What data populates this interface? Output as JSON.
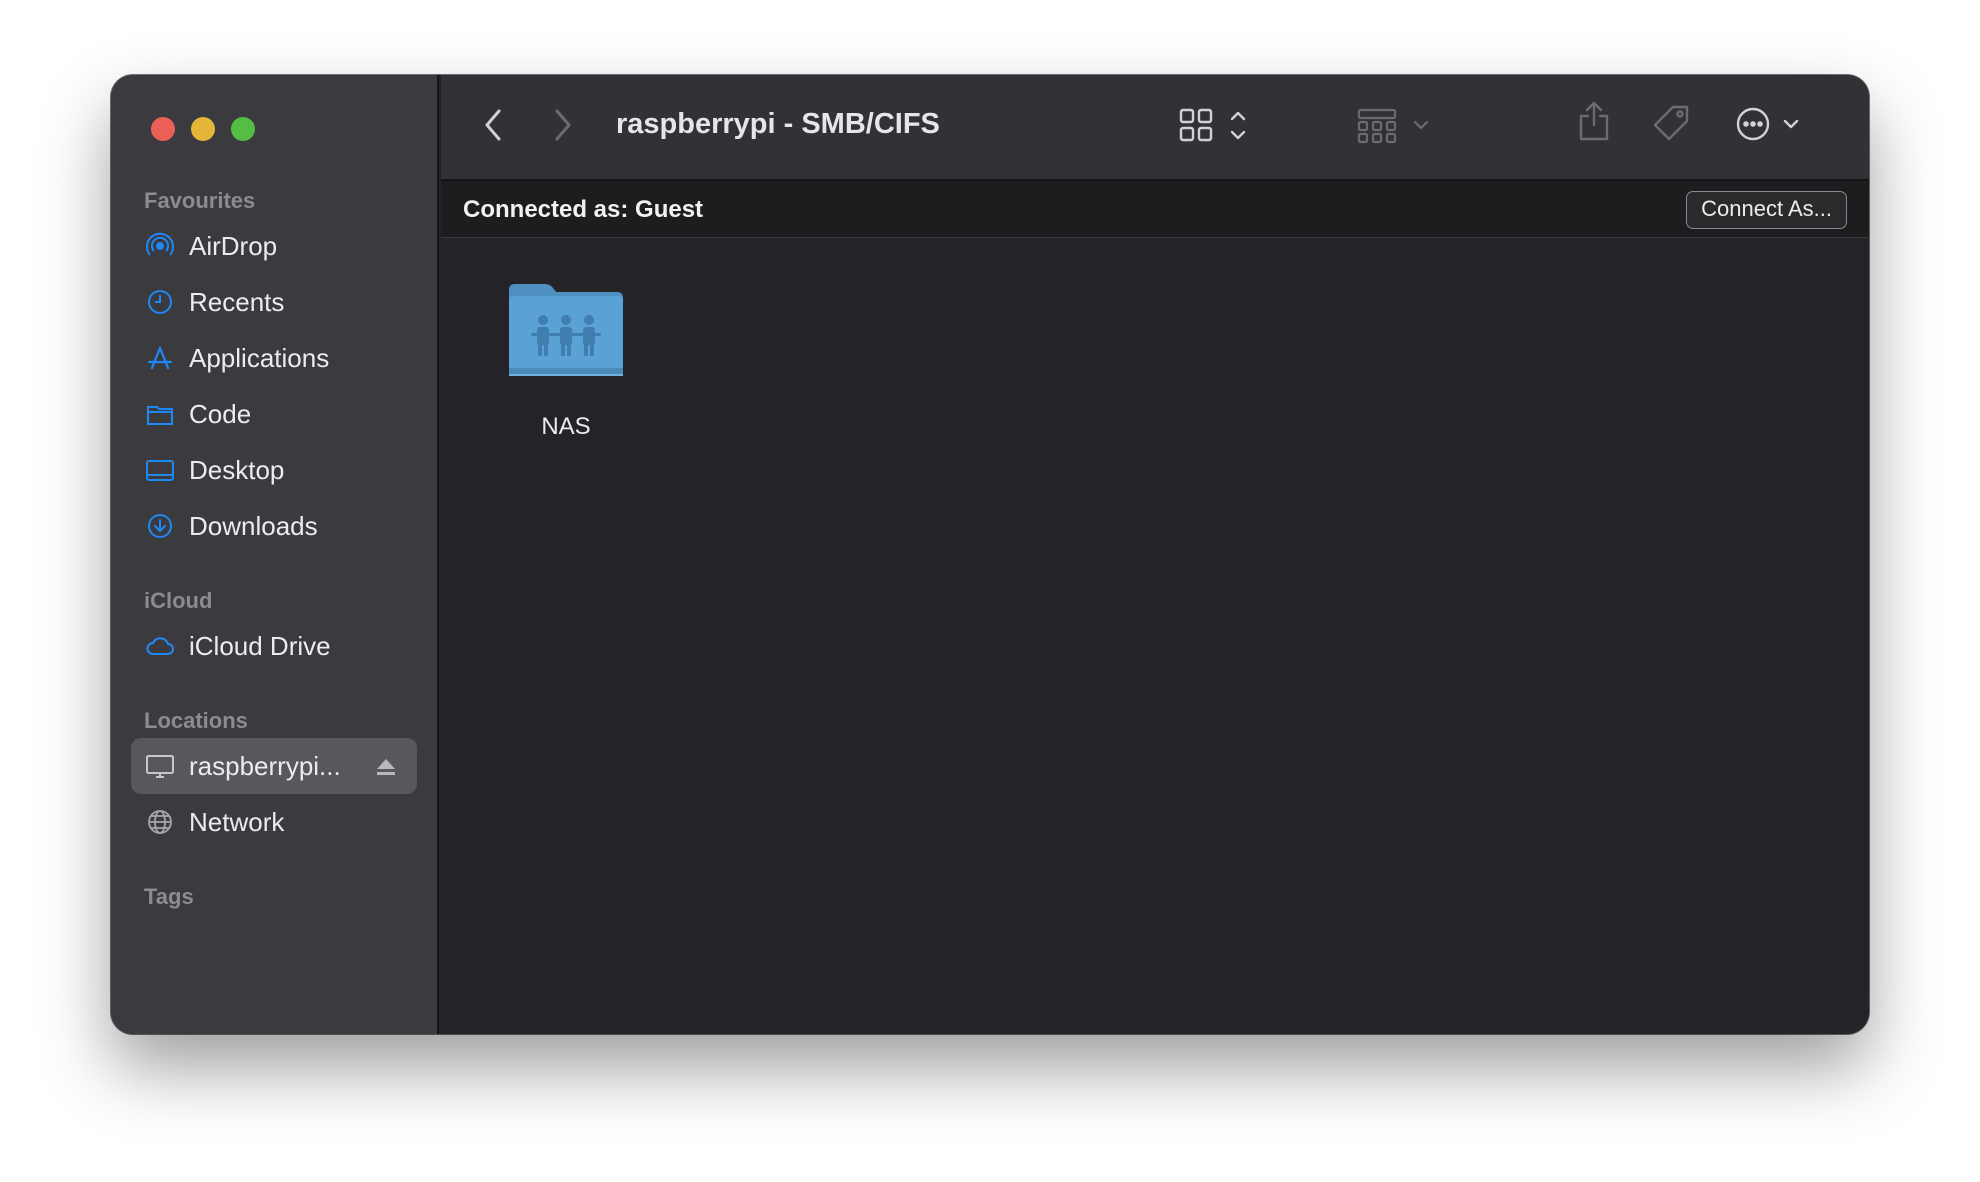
{
  "window": {
    "title": "raspberrypi - SMB/CIFS"
  },
  "sidebar": {
    "sections": {
      "favourites": "Favourites",
      "icloud": "iCloud",
      "locations": "Locations",
      "tags": "Tags"
    },
    "favourites": [
      {
        "label": "AirDrop",
        "icon": "airdrop-icon"
      },
      {
        "label": "Recents",
        "icon": "clock-icon"
      },
      {
        "label": "Applications",
        "icon": "applications-icon"
      },
      {
        "label": "Code",
        "icon": "folder-icon"
      },
      {
        "label": "Desktop",
        "icon": "desktop-icon"
      },
      {
        "label": "Downloads",
        "icon": "download-icon"
      }
    ],
    "icloud": [
      {
        "label": "iCloud Drive",
        "icon": "cloud-icon"
      }
    ],
    "locations": [
      {
        "label": "raspberrypi...",
        "icon": "computer-icon",
        "selected": true
      },
      {
        "label": "Network",
        "icon": "globe-icon"
      }
    ]
  },
  "connection": {
    "status": "Connected as: Guest",
    "button": "Connect As..."
  },
  "files": [
    {
      "name": "NAS",
      "icon": "shared-folder-icon"
    }
  ],
  "colors": {
    "accent": "#1e88f5",
    "folder": "#5aa2d6",
    "sidebar_bg": "#3b3b3f",
    "content_bg": "#242428"
  }
}
